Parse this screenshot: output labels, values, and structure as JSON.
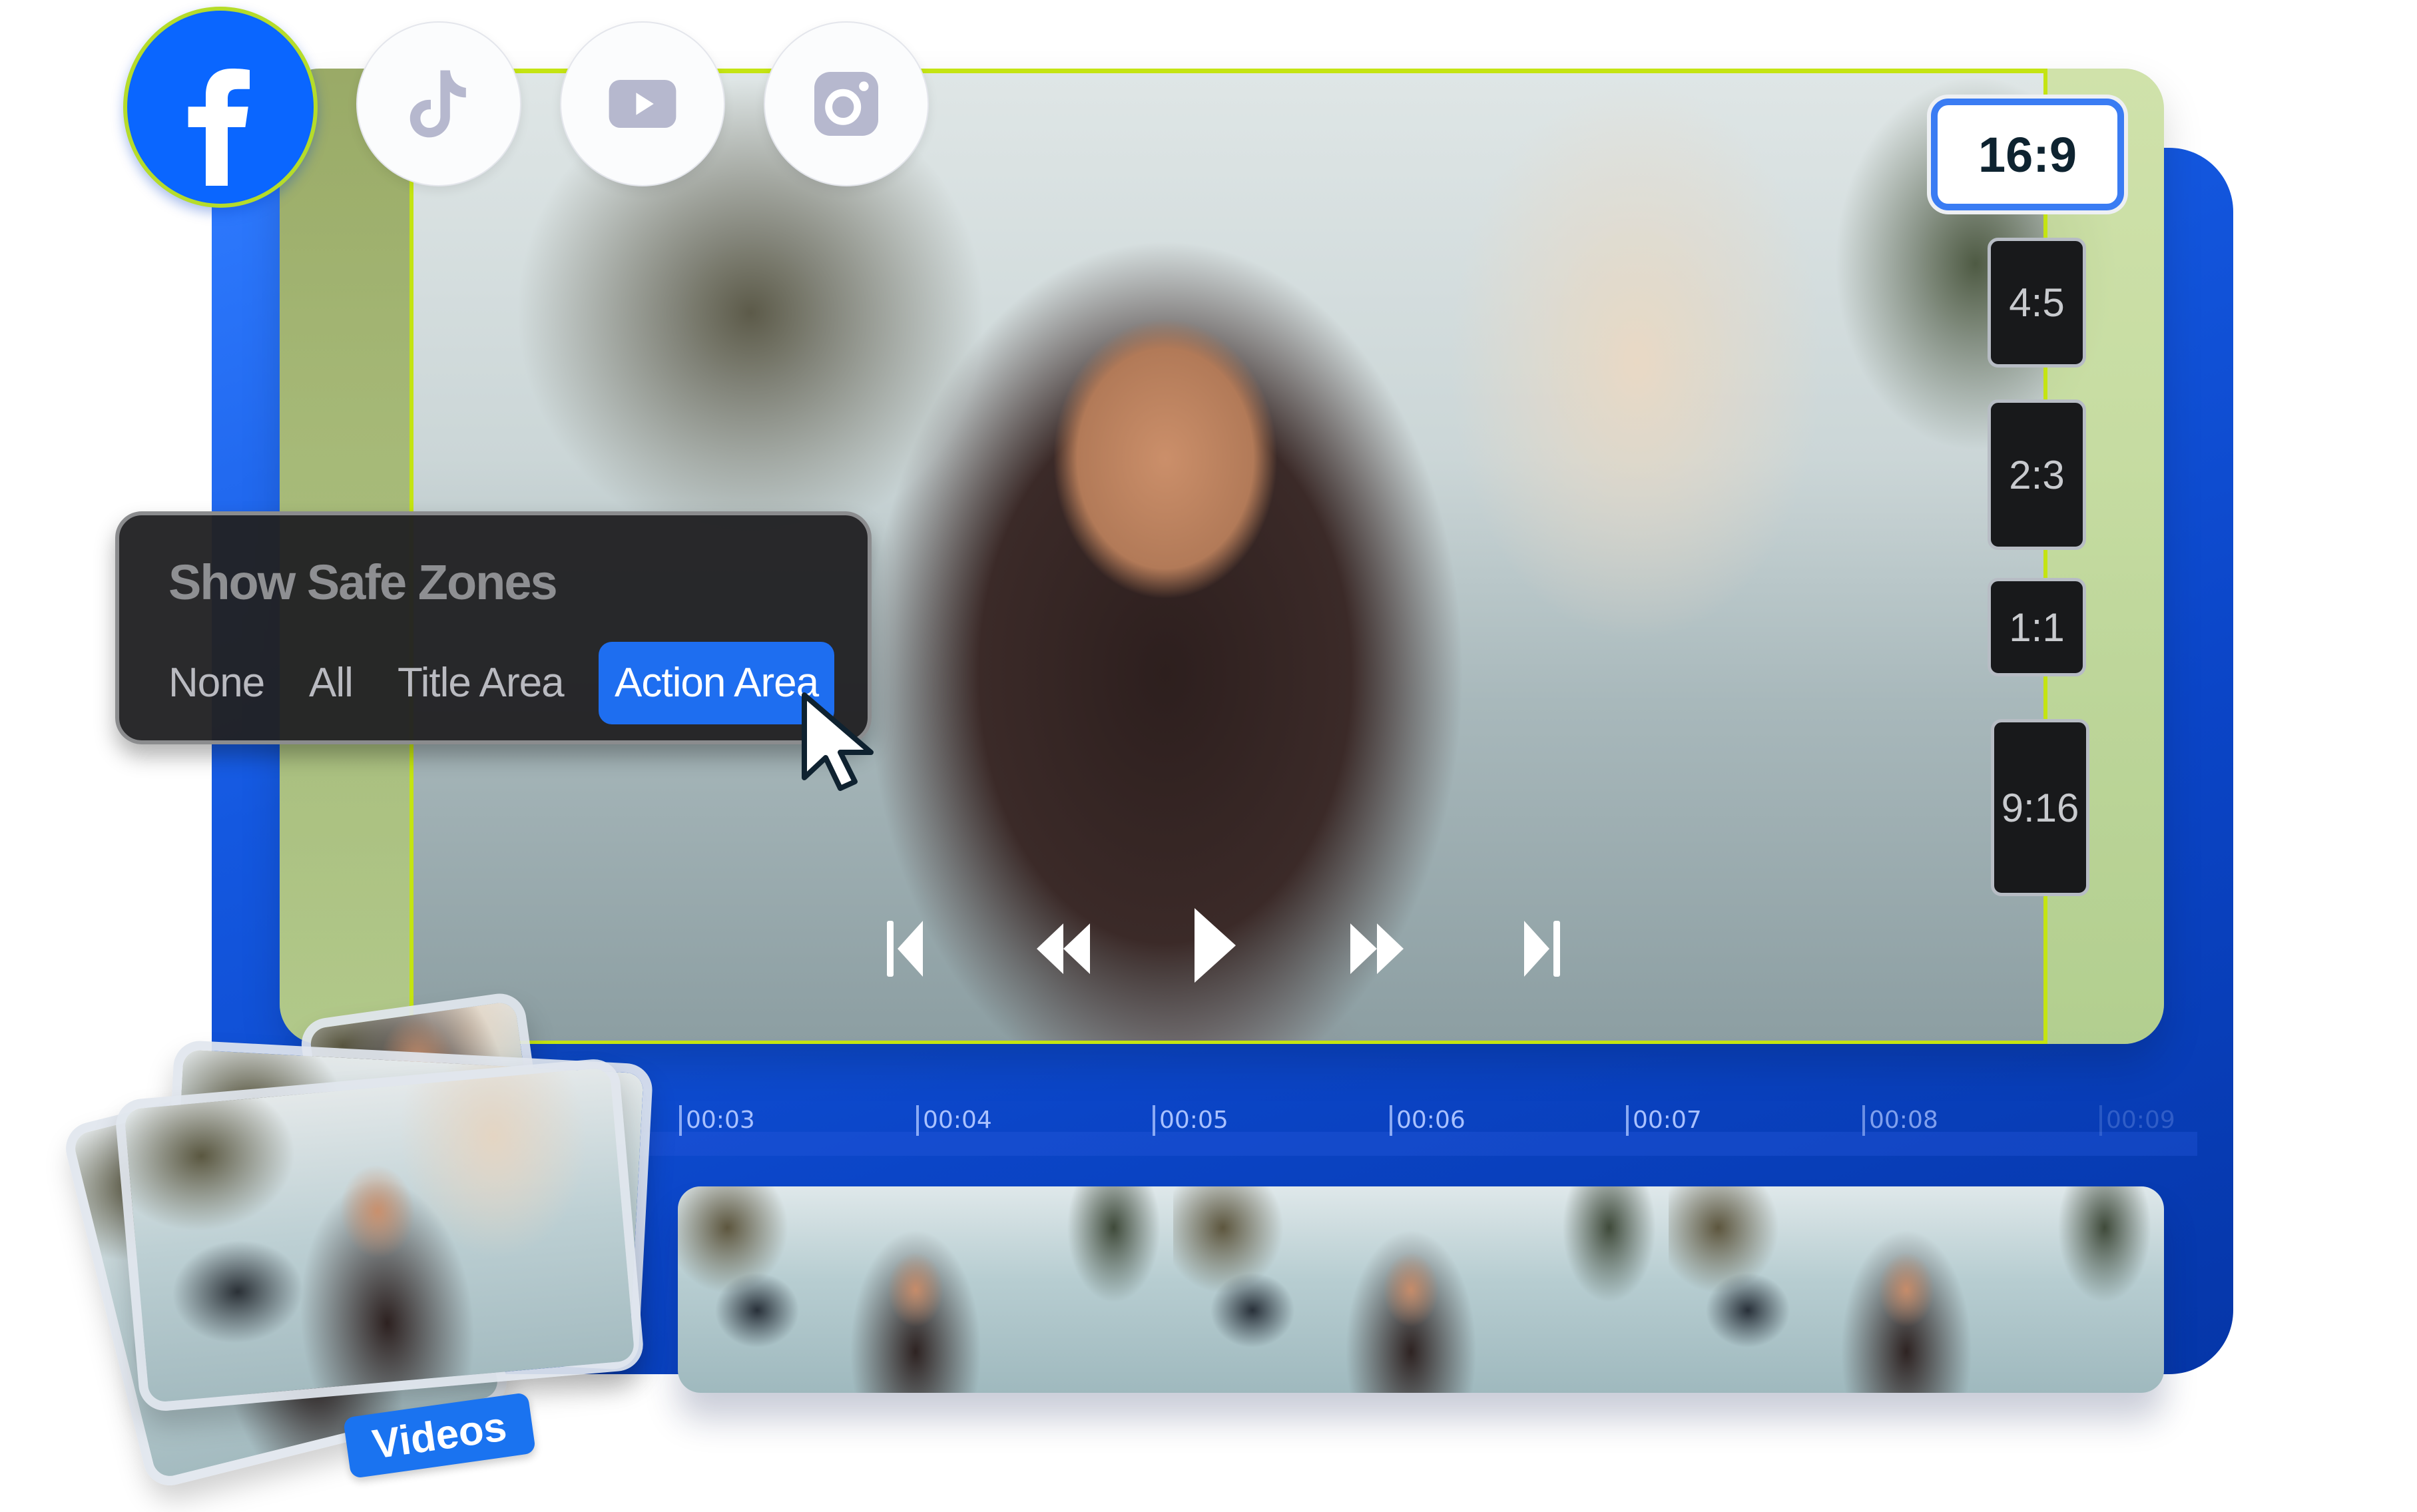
{
  "social_platforms": [
    {
      "name": "Facebook",
      "icon": "facebook-icon",
      "active": true,
      "color": "#0a66ff"
    },
    {
      "name": "TikTok",
      "icon": "tiktok-icon",
      "active": false,
      "color": "#b6b8ce"
    },
    {
      "name": "YouTube",
      "icon": "youtube-icon",
      "active": false,
      "color": "#b6b8ce"
    },
    {
      "name": "Instagram",
      "icon": "instagram-icon",
      "active": false,
      "color": "#b6b8ce"
    }
  ],
  "aspect_ratios": [
    {
      "label": "16:9",
      "active": true
    },
    {
      "label": "4:5",
      "active": false
    },
    {
      "label": "2:3",
      "active": false
    },
    {
      "label": "1:1",
      "active": false
    },
    {
      "label": "9:16",
      "active": false
    }
  ],
  "safe_zones": {
    "title": "Show Safe Zones",
    "options": [
      "None",
      "All",
      "Title Area",
      "Action Area"
    ],
    "selected": "Action Area"
  },
  "playback_controls": [
    "skip-to-start",
    "rewind",
    "play",
    "fast-forward",
    "skip-to-end"
  ],
  "timeline": {
    "ticks": [
      "00:03",
      "00:04",
      "00:05",
      "00:06",
      "00:07",
      "00:08",
      "00:09"
    ]
  },
  "media_library": {
    "badge_label": "Videos"
  },
  "colors": {
    "accent_blue": "#1e6ef0",
    "safe_zone_outline": "#c4e412",
    "panel_dark": "#212123"
  }
}
